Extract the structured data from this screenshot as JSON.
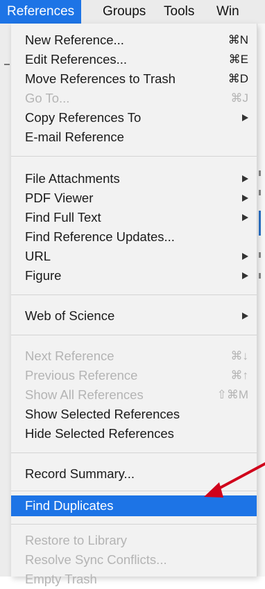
{
  "menubar": {
    "items": [
      "References",
      "Groups",
      "Tools",
      "Win"
    ],
    "active_index": 0
  },
  "menu": {
    "items": [
      {
        "label": "New Reference...",
        "shortcut": "⌘N",
        "submenu": false,
        "enabled": true
      },
      {
        "label": "Edit References...",
        "shortcut": "⌘E",
        "submenu": false,
        "enabled": true
      },
      {
        "label": "Move References to Trash",
        "shortcut": "⌘D",
        "submenu": false,
        "enabled": true
      },
      {
        "label": "Go To...",
        "shortcut": "⌘J",
        "submenu": false,
        "enabled": false
      },
      {
        "label": "Copy References To",
        "shortcut": "",
        "submenu": true,
        "enabled": true
      },
      {
        "label": "E-mail Reference",
        "shortcut": "",
        "submenu": false,
        "enabled": true
      },
      {
        "label": "File Attachments",
        "shortcut": "",
        "submenu": true,
        "enabled": true
      },
      {
        "label": "PDF Viewer",
        "shortcut": "",
        "submenu": true,
        "enabled": true
      },
      {
        "label": "Find Full Text",
        "shortcut": "",
        "submenu": true,
        "enabled": true
      },
      {
        "label": "Find Reference Updates...",
        "shortcut": "",
        "submenu": false,
        "enabled": true
      },
      {
        "label": "URL",
        "shortcut": "",
        "submenu": true,
        "enabled": true
      },
      {
        "label": "Figure",
        "shortcut": "",
        "submenu": true,
        "enabled": true
      },
      {
        "label": "Web of Science",
        "shortcut": "",
        "submenu": true,
        "enabled": true
      },
      {
        "label": "Next Reference",
        "shortcut": "⌘↓",
        "submenu": false,
        "enabled": false
      },
      {
        "label": "Previous Reference",
        "shortcut": "⌘↑",
        "submenu": false,
        "enabled": false
      },
      {
        "label": "Show All References",
        "shortcut": "⇧⌘M",
        "submenu": false,
        "enabled": false
      },
      {
        "label": "Show Selected References",
        "shortcut": "",
        "submenu": false,
        "enabled": true
      },
      {
        "label": "Hide Selected References",
        "shortcut": "",
        "submenu": false,
        "enabled": true
      },
      {
        "label": "Record Summary...",
        "shortcut": "",
        "submenu": false,
        "enabled": true
      },
      {
        "label": "Find Duplicates",
        "shortcut": "",
        "submenu": false,
        "enabled": true,
        "highlighted": true
      },
      {
        "label": "Restore to Library",
        "shortcut": "",
        "submenu": false,
        "enabled": false
      },
      {
        "label": "Resolve Sync Conflicts...",
        "shortcut": "",
        "submenu": false,
        "enabled": false
      },
      {
        "label": "Empty Trash",
        "shortcut": "",
        "submenu": false,
        "enabled": false
      }
    ]
  },
  "colors": {
    "highlight": "#1d74e6",
    "annotation_arrow": "#d0021b",
    "disabled_text": "#b4b4b4"
  }
}
